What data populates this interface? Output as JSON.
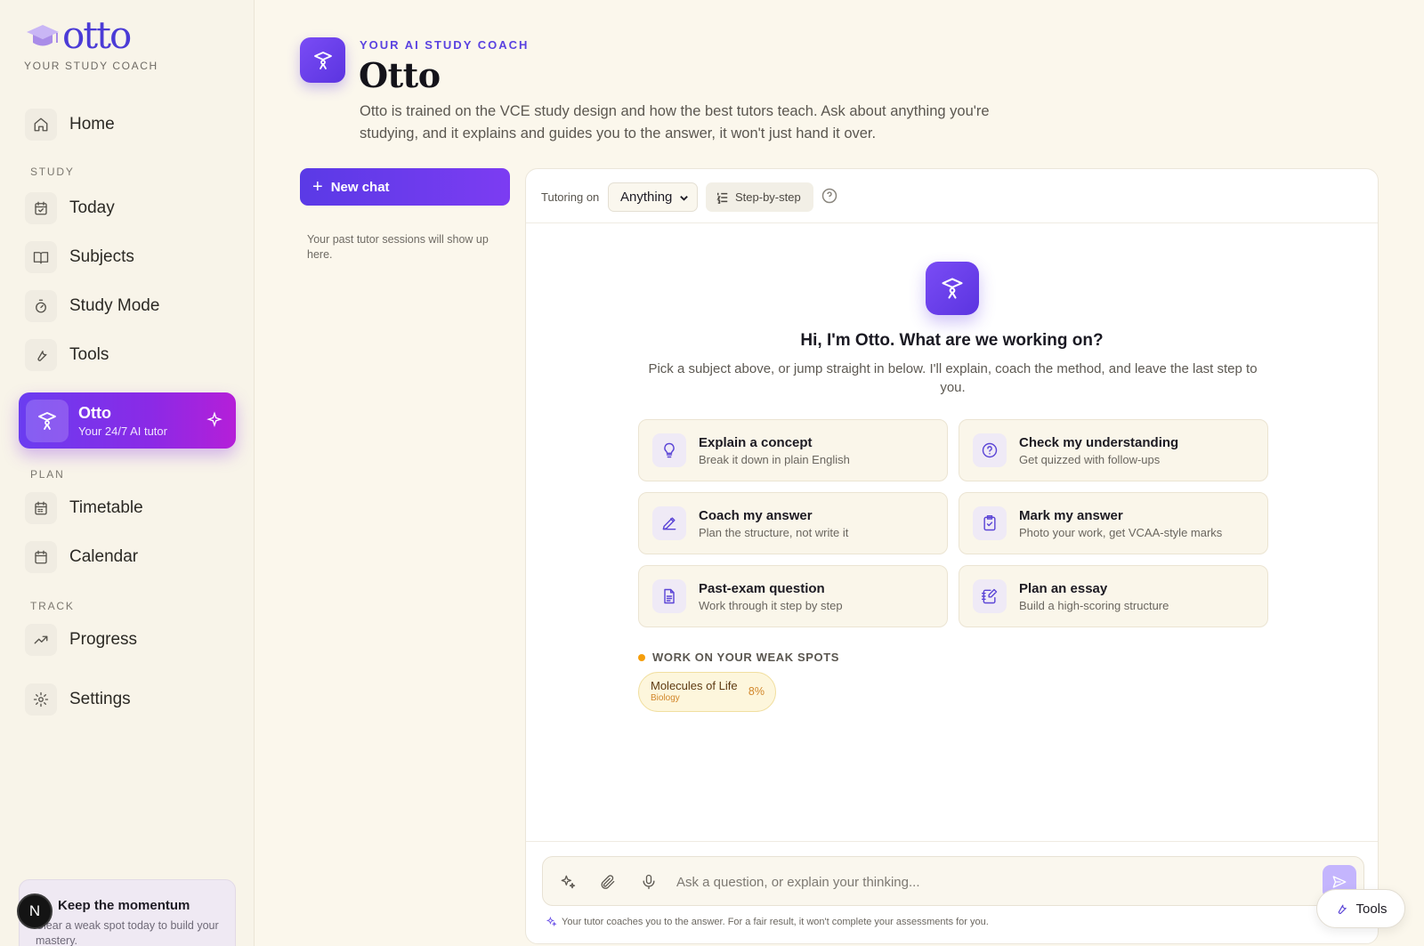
{
  "brand": {
    "logo_text": "otto",
    "tagline": "YOUR STUDY COACH"
  },
  "sidebar": {
    "home": "Home",
    "study_section": "STUDY",
    "today": "Today",
    "subjects": "Subjects",
    "study_mode": "Study Mode",
    "tools": "Tools",
    "otto": {
      "title": "Otto",
      "subtitle": "Your 24/7 AI tutor"
    },
    "plan_section": "PLAN",
    "timetable": "Timetable",
    "calendar": "Calendar",
    "track_section": "TRACK",
    "progress": "Progress",
    "settings": "Settings",
    "momentum": {
      "title": "Keep the momentum",
      "text": "Clear a weak spot today to build your mastery."
    },
    "avatar_initial": "N"
  },
  "header": {
    "eyebrow": "YOUR AI STUDY COACH",
    "title": "Otto",
    "description": "Otto is trained on the VCE study design and how the best tutors teach. Ask about anything you're studying, and it explains and guides you to the answer, it won't just hand it over."
  },
  "chats": {
    "new_chat_label": "New chat",
    "empty_text": "Your past tutor sessions will show up here."
  },
  "toolbar": {
    "tutoring_label": "Tutoring on",
    "subject_value": "Anything",
    "mode_label": "Step-by-step"
  },
  "welcome": {
    "title": "Hi, I'm Otto. What are we working on?",
    "subtitle": "Pick a subject above, or jump straight in below. I'll explain, coach the method, and leave the last step to you."
  },
  "cards": [
    {
      "title": "Explain a concept",
      "subtitle": "Break it down in plain English"
    },
    {
      "title": "Check my understanding",
      "subtitle": "Get quizzed with follow-ups"
    },
    {
      "title": "Coach my answer",
      "subtitle": "Plan the structure, not write it"
    },
    {
      "title": "Mark my answer",
      "subtitle": "Photo your work, get VCAA-style marks"
    },
    {
      "title": "Past-exam question",
      "subtitle": "Work through it step by step"
    },
    {
      "title": "Plan an essay",
      "subtitle": "Build a high-scoring structure"
    }
  ],
  "weak_spots": {
    "label": "WORK ON YOUR WEAK SPOTS",
    "items": [
      {
        "topic": "Molecules of Life",
        "subject": "Biology",
        "percent": "8%"
      }
    ]
  },
  "composer": {
    "placeholder": "Ask a question, or explain your thinking...",
    "disclaimer": "Your tutor coaches you to the answer. For a fair result, it won't complete your assessments for you."
  },
  "fab": {
    "tools_label": "Tools"
  },
  "colors": {
    "accent": "#5b34e0",
    "background": "#fbf7ec",
    "weak_spot": "#f59e0b"
  }
}
